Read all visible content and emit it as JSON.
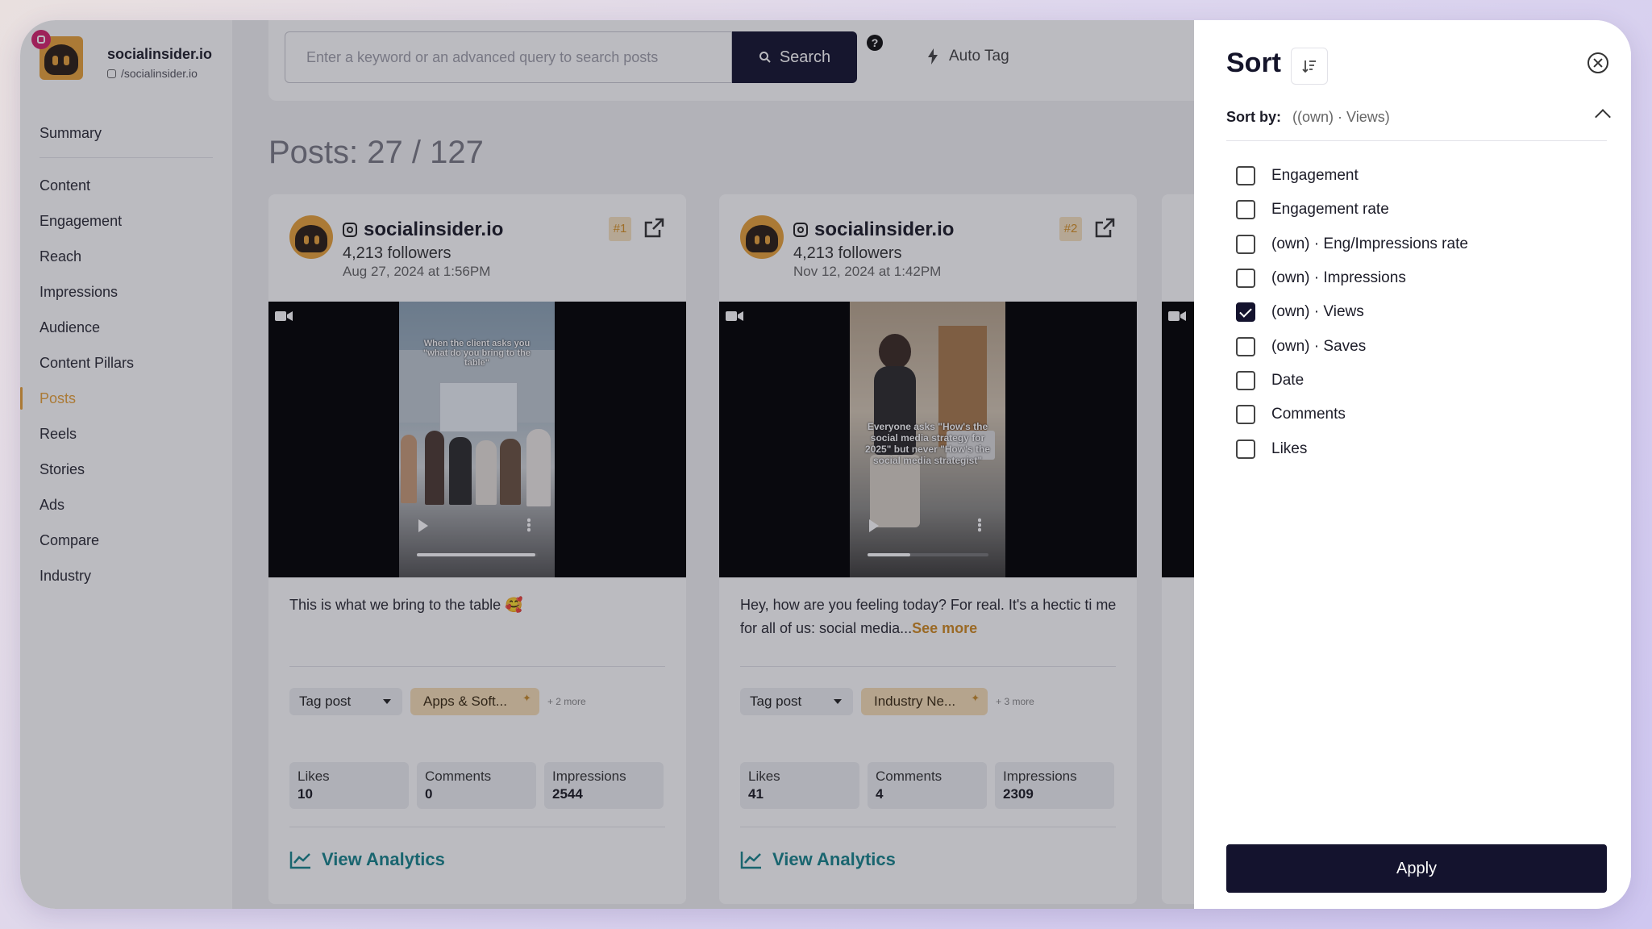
{
  "brand": {
    "name": "socialinsider.io",
    "handle": "/socialinsider.io"
  },
  "nav": {
    "top": [
      "Summary"
    ],
    "items": [
      "Content",
      "Engagement",
      "Reach",
      "Impressions",
      "Audience",
      "Content Pillars",
      "Posts",
      "Reels",
      "Stories",
      "Ads",
      "Compare",
      "Industry"
    ],
    "active": "Posts"
  },
  "search": {
    "placeholder": "Enter a keyword or an advanced query to search posts",
    "button": "Search",
    "help": "?",
    "autotag": "Auto Tag"
  },
  "posts_count": "Posts: 27 / 127",
  "posts": [
    {
      "account": "socialinsider.io",
      "followers": "4,213 followers",
      "date": "Aug 27, 2024 at 1:56PM",
      "rank": "#1",
      "overlay_text": "When the client asks you \"what do you bring to the table\"",
      "video_progress": 0.98,
      "caption": "This is what we bring to the table 🥰",
      "see_more": "",
      "tag_select": "Tag post",
      "tag_chip": "Apps & Soft...",
      "more_tags": "+ 2 more",
      "stats": [
        {
          "label": "Likes",
          "value": "10"
        },
        {
          "label": "Comments",
          "value": "0"
        },
        {
          "label": "Impressions",
          "value": "2544"
        }
      ],
      "analytics": "View Analytics"
    },
    {
      "account": "socialinsider.io",
      "followers": "4,213 followers",
      "date": "Nov 12, 2024 at 1:42PM",
      "rank": "#2",
      "overlay_text": "Everyone asks \"How's the social media strategy for 2025\" but never \"How's the social media strategist\"",
      "video_progress": 0.35,
      "caption": "Hey, how are you feeling today? For real. It's a hectic ti me for all of us: social media...",
      "see_more": "See more",
      "tag_select": "Tag post",
      "tag_chip": "Industry Ne...",
      "more_tags": "+ 3 more",
      "stats": [
        {
          "label": "Likes",
          "value": "41"
        },
        {
          "label": "Comments",
          "value": "4"
        },
        {
          "label": "Impressions",
          "value": "2309"
        }
      ],
      "analytics": "View Analytics"
    }
  ],
  "sort_panel": {
    "title": "Sort",
    "sort_by_label": "Sort by:",
    "sort_by_value": "((own) · Views)",
    "options": [
      {
        "label": "Engagement",
        "checked": false
      },
      {
        "label": "Engagement rate",
        "checked": false
      },
      {
        "label": "(own) · Eng/Impressions rate",
        "checked": false
      },
      {
        "label": "(own) · Impressions",
        "checked": false
      },
      {
        "label": "(own) · Views",
        "checked": true
      },
      {
        "label": "(own) · Saves",
        "checked": false
      },
      {
        "label": "Date",
        "checked": false
      },
      {
        "label": "Comments",
        "checked": false
      },
      {
        "label": "Likes",
        "checked": false
      }
    ],
    "apply": "Apply"
  },
  "colors": {
    "accent": "#e8a33a",
    "dark": "#14132e",
    "teal": "#17848c"
  }
}
